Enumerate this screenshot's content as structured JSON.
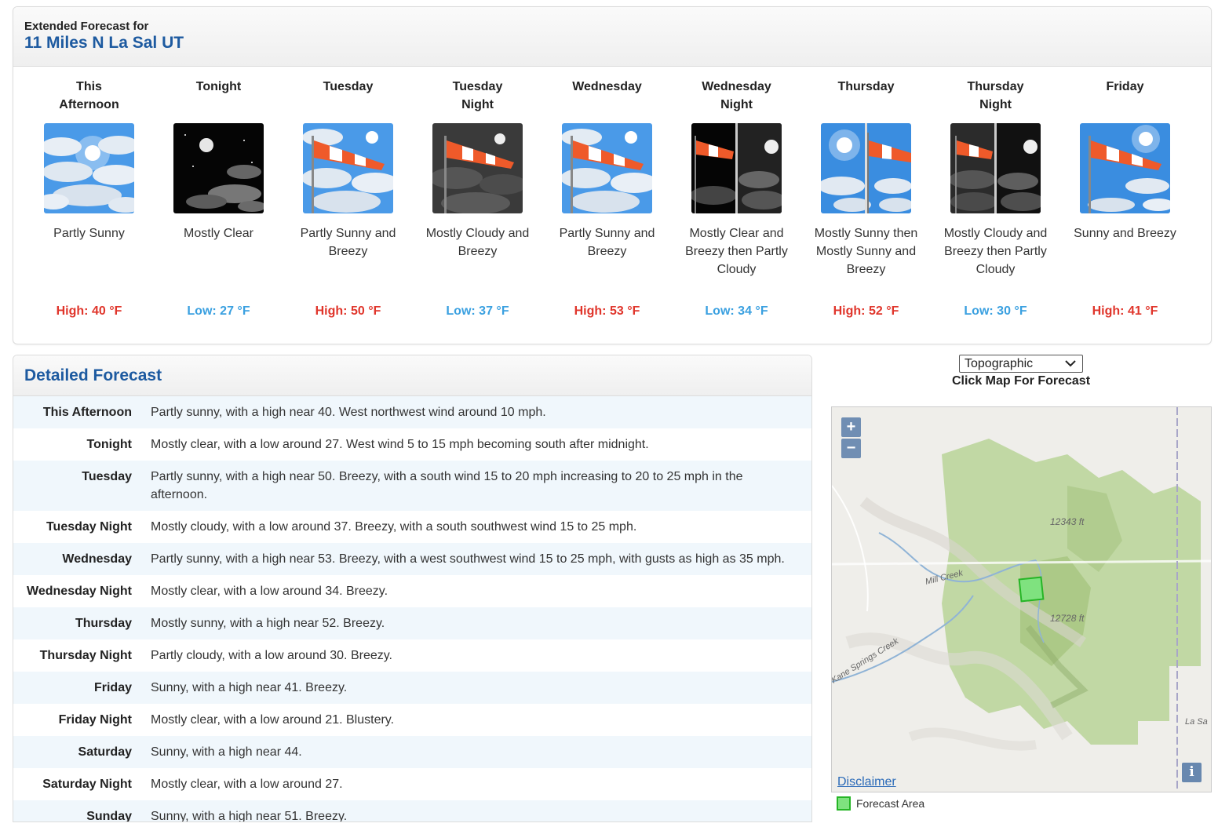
{
  "extended": {
    "subtitle": "Extended Forecast for",
    "location": "11 Miles N La Sal UT",
    "periods": [
      {
        "name_line1": "This",
        "name_line2": "Afternoon",
        "icon": "partly-sunny-icon",
        "short": "Partly Sunny",
        "temp": "High: 40 °F",
        "kind": "high"
      },
      {
        "name_line1": "Tonight",
        "name_line2": "",
        "icon": "mostly-clear-night-icon",
        "short": "Mostly Clear",
        "temp": "Low: 27 °F",
        "kind": "low"
      },
      {
        "name_line1": "Tuesday",
        "name_line2": "",
        "icon": "windy-partly-sunny-icon",
        "short": "Partly Sunny and Breezy",
        "temp": "High: 50 °F",
        "kind": "high"
      },
      {
        "name_line1": "Tuesday",
        "name_line2": "Night",
        "icon": "windy-mostly-cloudy-night-icon",
        "short": "Mostly Cloudy and Breezy",
        "temp": "Low: 37 °F",
        "kind": "low"
      },
      {
        "name_line1": "Wednesday",
        "name_line2": "",
        "icon": "windy-partly-sunny-icon",
        "short": "Partly Sunny and Breezy",
        "temp": "High: 53 °F",
        "kind": "high"
      },
      {
        "name_line1": "Wednesday",
        "name_line2": "Night",
        "icon": "windy-clear-then-partly-cloudy-night-icon",
        "short": "Mostly Clear and Breezy then Partly Cloudy",
        "temp": "Low: 34 °F",
        "kind": "low"
      },
      {
        "name_line1": "Thursday",
        "name_line2": "",
        "icon": "mostly-sunny-then-windy-icon",
        "short": "Mostly Sunny then Mostly Sunny and Breezy",
        "temp": "High: 52 °F",
        "kind": "high"
      },
      {
        "name_line1": "Thursday",
        "name_line2": "Night",
        "icon": "windy-cloudy-then-partly-cloudy-night-icon",
        "short": "Mostly Cloudy and Breezy then Partly Cloudy",
        "temp": "Low: 30 °F",
        "kind": "low"
      },
      {
        "name_line1": "Friday",
        "name_line2": "",
        "icon": "windy-sunny-icon",
        "short": "Sunny and Breezy",
        "temp": "High: 41 °F",
        "kind": "high"
      }
    ]
  },
  "detailed": {
    "title": "Detailed Forecast",
    "rows": [
      {
        "label": "This Afternoon",
        "text": "Partly sunny, with a high near 40. West northwest wind around 10 mph."
      },
      {
        "label": "Tonight",
        "text": "Mostly clear, with a low around 27. West wind 5 to 15 mph becoming south after midnight."
      },
      {
        "label": "Tuesday",
        "text": "Partly sunny, with a high near 50. Breezy, with a south wind 15 to 20 mph increasing to 20 to 25 mph in the afternoon."
      },
      {
        "label": "Tuesday Night",
        "text": "Mostly cloudy, with a low around 37. Breezy, with a south southwest wind 15 to 25 mph."
      },
      {
        "label": "Wednesday",
        "text": "Partly sunny, with a high near 53. Breezy, with a west southwest wind 15 to 25 mph, with gusts as high as 35 mph."
      },
      {
        "label": "Wednesday Night",
        "text": "Mostly clear, with a low around 34. Breezy."
      },
      {
        "label": "Thursday",
        "text": "Mostly sunny, with a high near 52. Breezy."
      },
      {
        "label": "Thursday Night",
        "text": "Partly cloudy, with a low around 30. Breezy."
      },
      {
        "label": "Friday",
        "text": "Sunny, with a high near 41. Breezy."
      },
      {
        "label": "Friday Night",
        "text": "Mostly clear, with a low around 21. Blustery."
      },
      {
        "label": "Saturday",
        "text": "Sunny, with a high near 44."
      },
      {
        "label": "Saturday Night",
        "text": "Mostly clear, with a low around 27."
      },
      {
        "label": "Sunday",
        "text": "Sunny, with a high near 51. Breezy."
      }
    ]
  },
  "map": {
    "layer_selected": "Topographic",
    "hint": "Click Map For Forecast",
    "zoom_in": "+",
    "zoom_out": "−",
    "disclaimer": "Disclaimer",
    "info": "i",
    "labels": {
      "peak1": "12343 ft",
      "peak2": "12728 ft",
      "creek1": "Mill Creek",
      "creek2": "Kane Springs Creek",
      "edge": "La Sa"
    },
    "legend": "Forecast Area"
  },
  "colors": {
    "title_blue": "#1d5aa0",
    "high_red": "#e0352b",
    "low_blue": "#3aa0e0",
    "forecast_area": "#7fe27f"
  }
}
